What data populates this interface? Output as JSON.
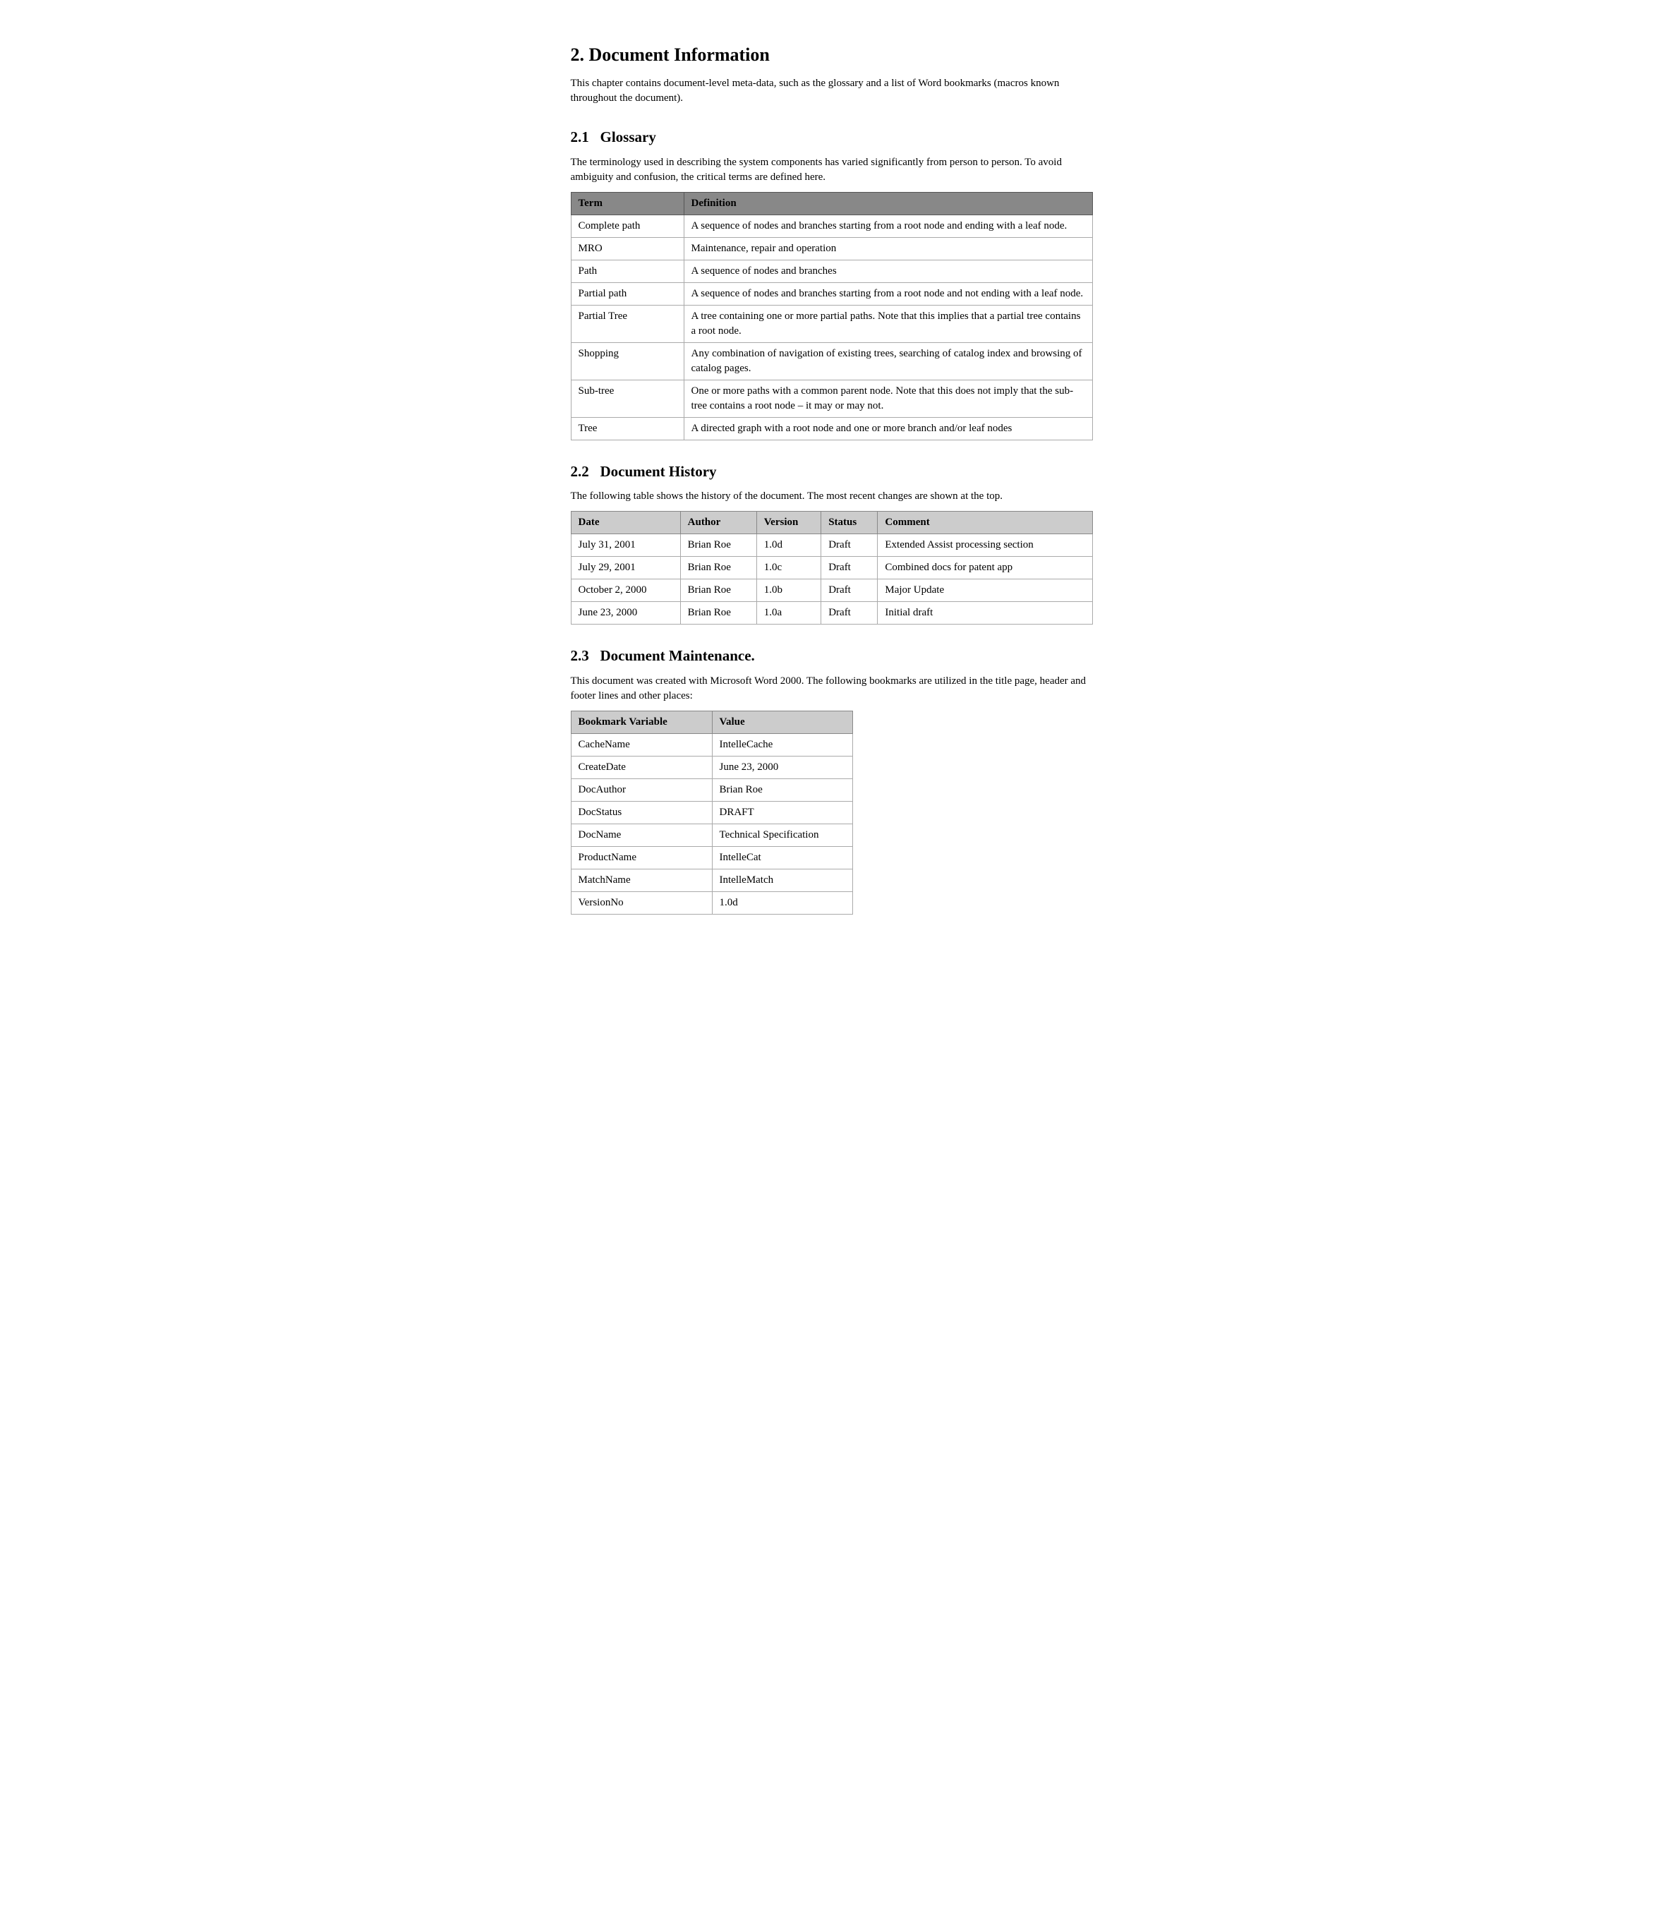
{
  "page": {
    "section_title": "2.   Document Information",
    "section_number": "2.",
    "section_name": "Document Information",
    "intro_text": "This chapter contains document-level meta-data, such as the glossary and a list of Word bookmarks (macros known throughout the document).",
    "glossary": {
      "subsection": "2.1",
      "title": "Glossary",
      "intro": "The terminology used in describing the system components has varied significantly from person to person.  To avoid ambiguity and confusion, the critical terms are defined here.",
      "table_headers": [
        "Term",
        "Definition"
      ],
      "rows": [
        {
          "term": "Complete path",
          "definition": "A sequence of nodes and branches starting from a root node and ending with a leaf node."
        },
        {
          "term": "MRO",
          "definition": "Maintenance, repair and operation"
        },
        {
          "term": "Path",
          "definition": "A sequence of nodes and branches"
        },
        {
          "term": "Partial path",
          "definition": "A sequence of nodes and branches starting from a root node and not ending with a leaf node."
        },
        {
          "term": "Partial Tree",
          "definition": "A tree containing one or more partial paths.  Note that this implies that a partial tree contains a root node."
        },
        {
          "term": "Shopping",
          "definition": "Any combination of navigation of existing trees, searching of catalog index and browsing of catalog pages."
        },
        {
          "term": "Sub-tree",
          "definition": "One or more paths with a common parent node.  Note that this does not imply that the sub-tree contains a root node – it may or may not."
        },
        {
          "term": "Tree",
          "definition": "A directed graph with a root node and one or more branch and/or leaf nodes"
        }
      ]
    },
    "history": {
      "subsection": "2.2",
      "title": "Document History",
      "intro": "The following table shows the history of the document.  The most recent changes are shown at the top.",
      "table_headers": [
        "Date",
        "Author",
        "Version",
        "Status",
        "Comment"
      ],
      "rows": [
        {
          "date": "July 31, 2001",
          "author": "Brian Roe",
          "version": "1.0d",
          "status": "Draft",
          "comment": "Extended Assist processing section"
        },
        {
          "date": "July 29, 2001",
          "author": "Brian Roe",
          "version": "1.0c",
          "status": "Draft",
          "comment": "Combined docs for patent app"
        },
        {
          "date": "October 2, 2000",
          "author": "Brian Roe",
          "version": "1.0b",
          "status": "Draft",
          "comment": "Major Update"
        },
        {
          "date": "June 23, 2000",
          "author": "Brian Roe",
          "version": "1.0a",
          "status": "Draft",
          "comment": "Initial draft"
        }
      ]
    },
    "maintenance": {
      "subsection": "2.3",
      "title": "Document Maintenance.",
      "intro": "This document was created with Microsoft Word 2000. The following bookmarks are utilized in the title page, header and footer lines and other places:",
      "table_headers": [
        "Bookmark Variable",
        "Value"
      ],
      "rows": [
        {
          "variable": "CacheName",
          "value": "IntelleCache"
        },
        {
          "variable": "CreateDate",
          "value": "June 23, 2000"
        },
        {
          "variable": "DocAuthor",
          "value": "Brian Roe"
        },
        {
          "variable": "DocStatus",
          "value": "DRAFT"
        },
        {
          "variable": "DocName",
          "value": "Technical Specification"
        },
        {
          "variable": "ProductName",
          "value": "IntelleCat"
        },
        {
          "variable": "MatchName",
          "value": "IntelleMatch"
        },
        {
          "variable": "VersionNo",
          "value": "1.0d"
        }
      ]
    }
  }
}
